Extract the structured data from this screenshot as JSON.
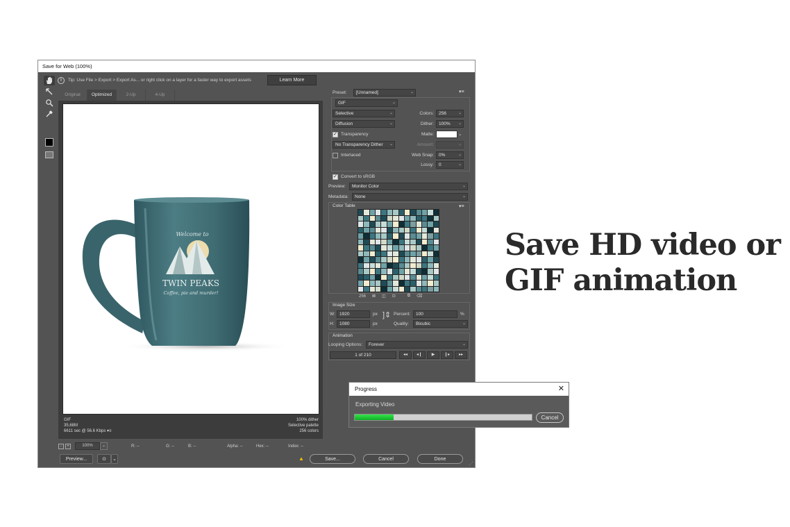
{
  "window": {
    "title": "Save for Web (100%)"
  },
  "tip": {
    "text": "Tip: Use File > Export > Export As...  or right click on a layer for a faster way to export assets",
    "learn_more": "Learn More"
  },
  "view_tabs": [
    {
      "label": "Original"
    },
    {
      "label": "Optimized"
    },
    {
      "label": "2-Up"
    },
    {
      "label": "4-Up"
    }
  ],
  "canvas": {
    "mug_text": {
      "welcome": "Welcome to",
      "name": "TWIN PEAKS",
      "tagline": "Coffee, pie and murder!"
    },
    "colors": {
      "mug": "#3f6b72",
      "sun": "#ecdcae"
    }
  },
  "status": {
    "left": [
      "GIF",
      "35,68M",
      "6611 sec @ 56.6 Kbps"
    ],
    "left_menu": "▾≡",
    "right": [
      "100% dither",
      "Selective palette",
      "256 colors"
    ]
  },
  "zoombar": {
    "zoom": "100%",
    "r": "R: --",
    "g": "G: --",
    "b": "B: --",
    "alpha": "Alpha: --",
    "hex": "Hex: --",
    "index": "Index: --"
  },
  "buttons": {
    "preview": "Preview...",
    "save": "Save...",
    "cancel": "Cancel",
    "done": "Done"
  },
  "settings": {
    "preset_label": "Preset:",
    "preset": "[Unnamed]",
    "format": "GIF",
    "reduction": "Selective",
    "dither_algo": "Diffusion",
    "transparency_label": "Transparency",
    "transparency_checked": true,
    "transparency_dither": "No Transparency Dither",
    "interlaced_label": "Interlaced",
    "interlaced_checked": false,
    "colors_label": "Colors:",
    "colors": "256",
    "dither_label": "Dither:",
    "dither": "100%",
    "matte_label": "Matte:",
    "amount_label": "Amount:",
    "websnap_label": "Web Snap:",
    "websnap": "0%",
    "lossy_label": "Lossy:",
    "lossy": "0",
    "convert_srgb_label": "Convert to sRGB",
    "convert_srgb_checked": true,
    "preview_label": "Preview:",
    "preview": "Monitor Color",
    "metadata_label": "Metadata:",
    "metadata": "None"
  },
  "color_table": {
    "title": "Color Table",
    "count": "256",
    "palette": [
      "#1f4b55",
      "#3c7680",
      "#6fa3a8",
      "#a9c9c6",
      "#e4e8da",
      "#f2ecd0",
      "#dfe6e8",
      "#0f2e36",
      "#5a8c93",
      "#8fb8bb",
      "#c6ddd9",
      "#2b5f69",
      "#d2d9c8",
      "#7d9ea0"
    ],
    "pattern": [
      0,
      4,
      2,
      6,
      1,
      9,
      3,
      11,
      5,
      0,
      8,
      2,
      10,
      7,
      3,
      1,
      5,
      8,
      0,
      12,
      4,
      6,
      2,
      9,
      11,
      1,
      7,
      3,
      6,
      9,
      0,
      3,
      10,
      2,
      5,
      7,
      1,
      13,
      4,
      8,
      2,
      0,
      11,
      2,
      8,
      4,
      6,
      0,
      9,
      3,
      12,
      1,
      5,
      10,
      7,
      4,
      2,
      7,
      1,
      9,
      3,
      11,
      5,
      0,
      6,
      8,
      2,
      4,
      13,
      1,
      9,
      0,
      4,
      6,
      12,
      2,
      7,
      1,
      10,
      3,
      0,
      5,
      8,
      6,
      5,
      1,
      8,
      0,
      4,
      10,
      2,
      9,
      6,
      12,
      3,
      7,
      1,
      2,
      3,
      9,
      5,
      11,
      1,
      6,
      4,
      0,
      8,
      2,
      13,
      5,
      10,
      7,
      7,
      2,
      0,
      8,
      3,
      12,
      5,
      1,
      9,
      4,
      6,
      11,
      2,
      0,
      1,
      6,
      10,
      4,
      2,
      7,
      0,
      8,
      3,
      5,
      12,
      1,
      9,
      4,
      8,
      3,
      5,
      1,
      9,
      6,
      11,
      2,
      4,
      10,
      0,
      7,
      3,
      6,
      0,
      11,
      2,
      7,
      5,
      1,
      3,
      12,
      6,
      8,
      4,
      2,
      10,
      1,
      2,
      5,
      9,
      3,
      0,
      8,
      4,
      7,
      1,
      11,
      6,
      9,
      5,
      3,
      6,
      1,
      4,
      12,
      7,
      2,
      10,
      5,
      0,
      3,
      8,
      1,
      13,
      9,
      3,
      8,
      1,
      6,
      0,
      9,
      2,
      4,
      12,
      7,
      1,
      5,
      10,
      2,
      4,
      0,
      7,
      2,
      11,
      5,
      3,
      8,
      1,
      6,
      9,
      4,
      0,
      7,
      10,
      5,
      3,
      9,
      1,
      4,
      8,
      0,
      6,
      2,
      11,
      3,
      7,
      1,
      1,
      7,
      2,
      10,
      6,
      3,
      0,
      9,
      4,
      12,
      8,
      5,
      2,
      6,
      9,
      2,
      6,
      0,
      8,
      4,
      11,
      1,
      7,
      3,
      5,
      10,
      4,
      13
    ]
  },
  "image_size": {
    "title": "Image Size",
    "w_label": "W:",
    "w": "1920",
    "h_label": "H:",
    "h": "1080",
    "unit": "px",
    "percent_label": "Percent:",
    "percent": "100",
    "percent_unit": "%",
    "quality_label": "Quality:",
    "quality": "Bicubic"
  },
  "animation": {
    "title": "Animation",
    "looping_label": "Looping Options:",
    "looping": "Forever",
    "frame": "1 of 210",
    "controls": [
      "◂◂",
      "◂❙",
      "▶",
      "❙▸",
      "▸▸"
    ]
  },
  "progress": {
    "title": "Progress",
    "message": "Exporting Video",
    "cancel": "Cancel",
    "percent": 22
  },
  "headline": {
    "line1": "Save HD video or",
    "line2": "GIF animation"
  }
}
